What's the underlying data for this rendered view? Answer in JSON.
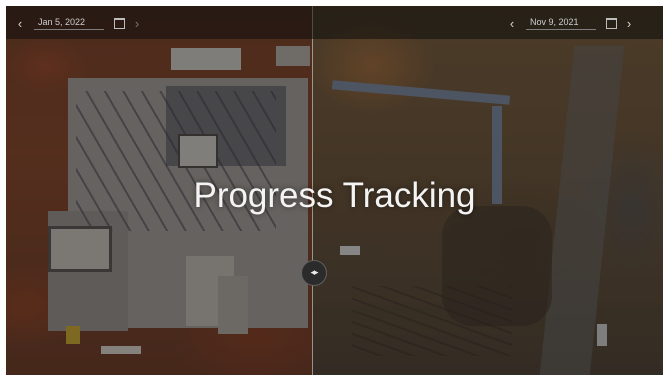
{
  "title": "Progress Tracking",
  "left_nav": {
    "date": "Jan 5, 2022",
    "prev_icon": "chevron-left-icon",
    "next_icon": "chevron-right-icon",
    "calendar_icon": "calendar-icon"
  },
  "right_nav": {
    "date": "Nov 9, 2021",
    "prev_icon": "chevron-left-icon",
    "next_icon": "chevron-right-icon",
    "calendar_icon": "calendar-icon"
  },
  "slider_handle_icon": "left-right-arrows-icon",
  "colors": {
    "overlay": "#141416",
    "text": "#f4f4f4",
    "divider": "#e6e6e6"
  }
}
